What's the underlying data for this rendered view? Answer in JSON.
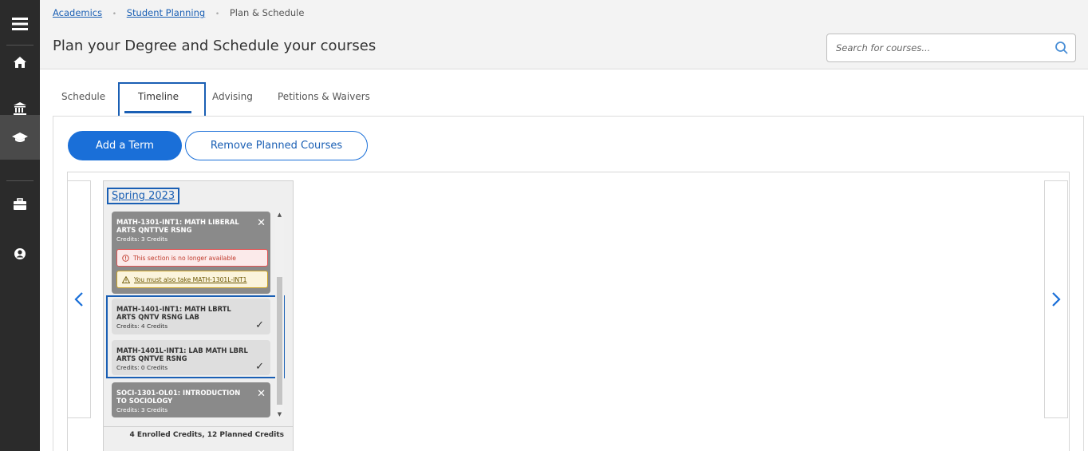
{
  "breadcrumb": {
    "items": [
      {
        "label": "Academics"
      },
      {
        "label": "Student Planning"
      },
      {
        "label": "Plan & Schedule"
      }
    ],
    "separator": "•"
  },
  "page": {
    "title": "Plan your Degree and Schedule your courses"
  },
  "search": {
    "placeholder": "Search for courses..."
  },
  "nav": {
    "icons": [
      "menu-icon",
      "home-icon",
      "institution-icon",
      "graduation-cap-icon",
      "briefcase-icon",
      "user-circle-icon"
    ],
    "active": "graduation-cap-icon"
  },
  "tabs": [
    {
      "label": "Schedule"
    },
    {
      "label": "Timeline"
    },
    {
      "label": "Advising"
    },
    {
      "label": "Petitions & Waivers"
    }
  ],
  "active_tab": "Timeline",
  "actions": {
    "add_term": "Add a Term",
    "remove_planned": "Remove Planned Courses"
  },
  "term": {
    "title": "Spring 2023",
    "courses": [
      {
        "title": "MATH-1301-INT1: MATH LIBERAL ARTS QNTTVE RSNG",
        "credits": "Credits: 3 Credits",
        "state": "planned",
        "alerts": [
          {
            "type": "error",
            "text": "This section is no longer available"
          },
          {
            "type": "warning",
            "text": "You must also take MATH-1301L-INT1"
          }
        ]
      },
      {
        "title": "MATH-1401-INT1: MATH LBRTL ARTS QNTV RSNG LAB",
        "credits": "Credits: 4 Credits",
        "state": "enrolled"
      },
      {
        "title": "MATH-1401L-INT1: LAB MATH LBRL ARTS QNTVE RSNG",
        "credits": "Credits: 0 Credits",
        "state": "enrolled"
      },
      {
        "title": "SOCI-1301-OL01: INTRODUCTION TO SOCIOLOGY",
        "credits": "Credits: 3 Credits",
        "state": "planned"
      }
    ],
    "summary": "4 Enrolled Credits, 12 Planned Credits"
  },
  "colors": {
    "accent": "#1a6fd8",
    "nav_bg": "#2b2b2b",
    "planned_course": "#8a8a8a",
    "enrolled_course": "#dedede",
    "error": "#e05555",
    "warning": "#c9a227"
  }
}
